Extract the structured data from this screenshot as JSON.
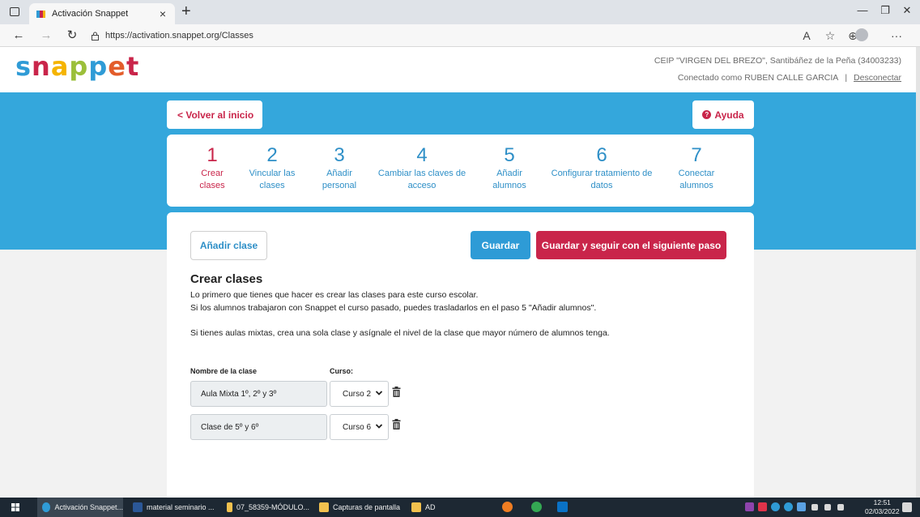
{
  "browser": {
    "tab_title": "Activación Snappet",
    "url": "https://activation.snappet.org/Classes"
  },
  "header": {
    "logo_letters": [
      {
        "ch": "s",
        "color": "#2f9bd6"
      },
      {
        "ch": "n",
        "color": "#c9254a"
      },
      {
        "ch": "a",
        "color": "#f5b400"
      },
      {
        "ch": "p",
        "color": "#9bbf3a"
      },
      {
        "ch": "p",
        "color": "#2f9bd6"
      },
      {
        "ch": "e",
        "color": "#e35d2b"
      },
      {
        "ch": "t",
        "color": "#c9254a"
      }
    ],
    "school": "CEIP \"VIRGEN DEL BREZO\", Santibáñez de la Peña (34003233)",
    "connected_as": "Conectado como RUBEN CALLE GARCIA",
    "separator": "|",
    "logout": "Desconectar"
  },
  "nav": {
    "back": "< Volver al inicio",
    "help": "Ayuda"
  },
  "steps": [
    {
      "num": "1",
      "label_line1": "Crear",
      "label_line2": "clases",
      "active": true
    },
    {
      "num": "2",
      "label_line1": "Vincular las",
      "label_line2": "clases",
      "active": false
    },
    {
      "num": "3",
      "label_line1": "Añadir",
      "label_line2": "personal",
      "active": false
    },
    {
      "num": "4",
      "label_line1": "Cambiar las claves de",
      "label_line2": "acceso",
      "active": false
    },
    {
      "num": "5",
      "label_line1": "Añadir",
      "label_line2": "alumnos",
      "active": false
    },
    {
      "num": "6",
      "label_line1": "Configurar tratamiento de",
      "label_line2": "datos",
      "active": false
    },
    {
      "num": "7",
      "label_line1": "Conectar",
      "label_line2": "alumnos",
      "active": false
    }
  ],
  "actions": {
    "add_class": "Añadir clase",
    "save": "Guardar",
    "save_next": "Guardar y seguir con el siguiente paso"
  },
  "content": {
    "title": "Crear clases",
    "p1": "Lo primero que tienes que hacer es crear las clases para este curso escolar.",
    "p2": "Si los alumnos trabajaron con Snappet el curso pasado, puedes trasladarlos en el paso 5 \"Añadir alumnos\".",
    "p3": "Si tienes aulas mixtas, crea una sola clase y asígnale el nivel de la clase que mayor número de alumnos tenga."
  },
  "table": {
    "col_name": "Nombre de la clase",
    "col_course": "Curso:",
    "rows": [
      {
        "name": "Aula Mixta 1º, 2º y 3º",
        "course": "Curso 2"
      },
      {
        "name": "Clase de 5º y 6º",
        "course": "Curso 6"
      }
    ]
  },
  "taskbar": {
    "items": [
      {
        "label": "Activación Snappet...",
        "color": "#2f9bd6"
      },
      {
        "label": "material seminario ...",
        "color": "#2b5797"
      },
      {
        "label": "07_58359-MÓDULO...",
        "color": "#f2c14e"
      },
      {
        "label": "Capturas de pantalla",
        "color": "#f2c14e"
      },
      {
        "label": "AD",
        "color": "#f2c14e"
      }
    ],
    "time": "12:51",
    "date": "02/03/2022"
  },
  "colors": {
    "brand_red": "#c9254a",
    "brand_blue": "#34a7dc",
    "link_blue": "#2e8fc7"
  }
}
